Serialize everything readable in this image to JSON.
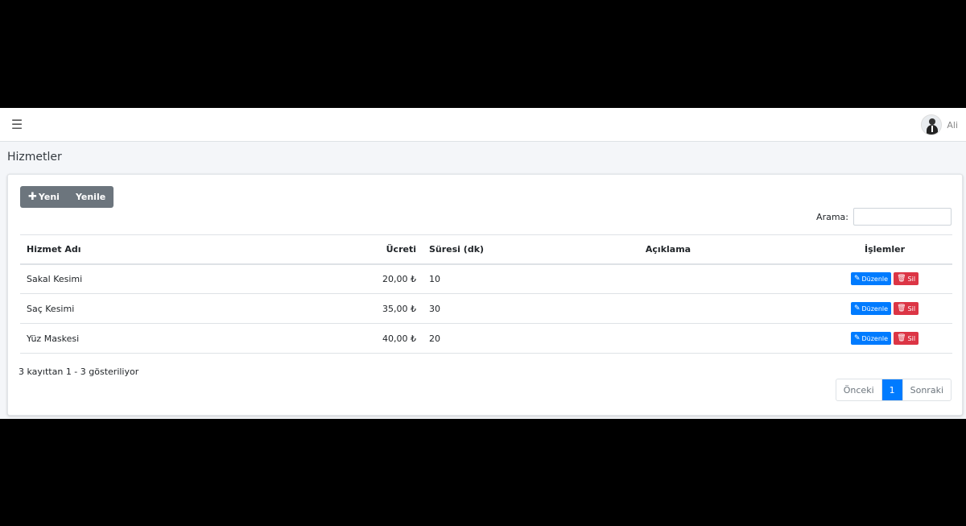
{
  "topbar": {
    "menu_icon": "hamburger-icon",
    "user_name": "Ali"
  },
  "page": {
    "title": "Hizmetler"
  },
  "toolbar": {
    "new_label": "Yeni",
    "refresh_label": "Yenile"
  },
  "search": {
    "label": "Arama:",
    "value": "",
    "placeholder": ""
  },
  "table": {
    "headers": {
      "name": "Hizmet Adı",
      "fee": "Ücreti",
      "duration": "Süresi (dk)",
      "description": "Açıklama",
      "actions": "İşlemler"
    },
    "rows": [
      {
        "name": "Sakal Kesimi",
        "fee": "20,00 ₺",
        "duration": "10",
        "description": ""
      },
      {
        "name": "Saç Kesimi",
        "fee": "35,00 ₺",
        "duration": "30",
        "description": ""
      },
      {
        "name": "Yüz Maskesi",
        "fee": "40,00 ₺",
        "duration": "20",
        "description": ""
      }
    ],
    "edit_label": "Düzenle",
    "delete_label": "Sil"
  },
  "footer": {
    "info": "3 kayıttan 1 - 3 gösteriliyor",
    "prev_label": "Önceki",
    "page_1": "1",
    "next_label": "Sonraki"
  },
  "colors": {
    "primary": "#007bff",
    "danger": "#dc3545",
    "secondary": "#6c757d"
  }
}
